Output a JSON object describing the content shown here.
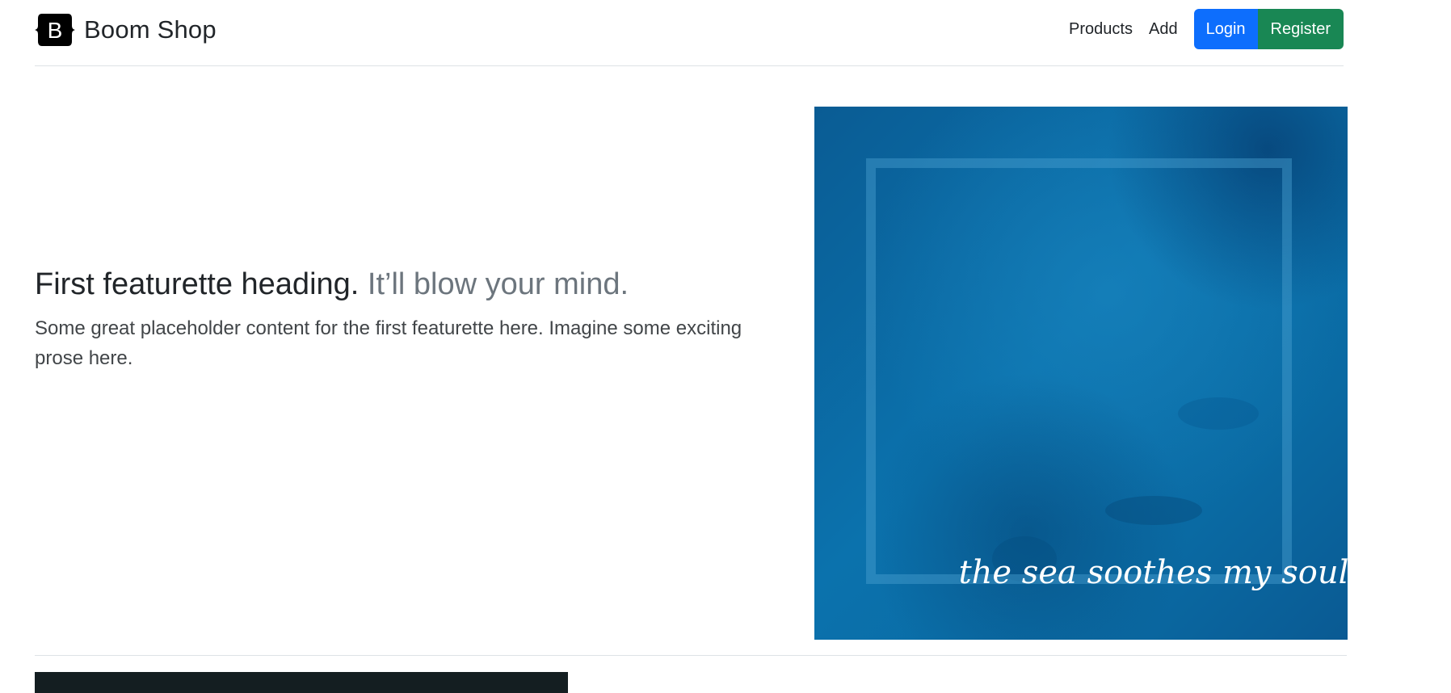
{
  "header": {
    "brand_name": "Boom Shop",
    "brand_letter": "B",
    "nav": {
      "products": "Products",
      "add": "Add"
    },
    "login_label": "Login",
    "register_label": "Register"
  },
  "featurette": {
    "heading_main": "First featurette heading.",
    "heading_muted": "It’ll blow your mind.",
    "lead": "Some great placeholder content for the first featurette here. Imagine some exciting prose here.",
    "image_caption": "the sea soothes my soul"
  },
  "colors": {
    "primary": "#0d6efd",
    "success": "#198754",
    "ocean": "#0a6aa6",
    "dark_panel": "#141e21"
  }
}
